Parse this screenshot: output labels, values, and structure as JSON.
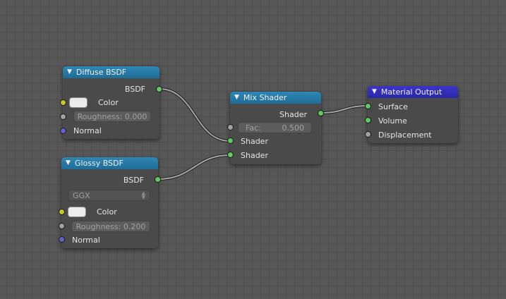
{
  "socket_colors": {
    "shader": "#63c763",
    "color": "#c7c729",
    "value": "#a1a1a1",
    "vector": "#6363c7"
  },
  "icons": {
    "collapse": "triangle-down-icon",
    "dropdown": "up-down-arrows-icon"
  },
  "nodes": {
    "diffuse": {
      "title": "Diffuse BSDF",
      "output": "BSDF",
      "color_label": "Color",
      "roughness": "Roughness: 0.000",
      "normal": "Normal"
    },
    "glossy": {
      "title": "Glossy BSDF",
      "output": "BSDF",
      "distribution": "GGX",
      "color_label": "Color",
      "roughness": "Roughness: 0.200",
      "normal": "Normal"
    },
    "mix": {
      "title": "Mix Shader",
      "output": "Shader",
      "fac_label": "Fac:",
      "fac_value": "0.500",
      "input1": "Shader",
      "input2": "Shader"
    },
    "output": {
      "title": "Material Output",
      "surface": "Surface",
      "volume": "Volume",
      "displacement": "Displacement"
    }
  }
}
